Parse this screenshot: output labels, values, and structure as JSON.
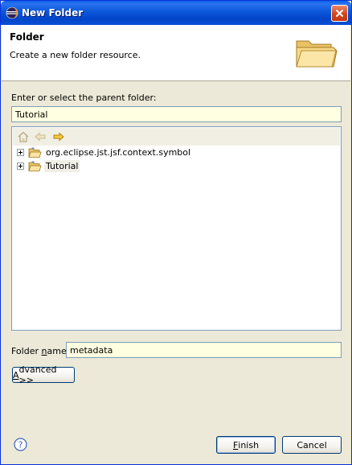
{
  "window": {
    "title": "New Folder"
  },
  "header": {
    "title": "Folder",
    "description": "Create a new folder resource."
  },
  "parent": {
    "label": "Enter or select the parent folder:",
    "value": "Tutorial"
  },
  "tree": {
    "toolbar": [
      "home-icon",
      "back-arrow-icon",
      "forward-arrow-icon"
    ],
    "items": [
      {
        "label": "org.eclipse.jst.jsf.context.symbol",
        "selected": false
      },
      {
        "label": "Tutorial",
        "selected": true
      }
    ]
  },
  "folder_name": {
    "label": "Folder name:",
    "value": "metadata"
  },
  "buttons": {
    "advanced": "Advanced >>",
    "finish": "Finish",
    "cancel": "Cancel"
  },
  "colors": {
    "titlebar": "#0b57db",
    "dialog_bg": "#ece9d8",
    "field_bg": "#ffffe1"
  }
}
